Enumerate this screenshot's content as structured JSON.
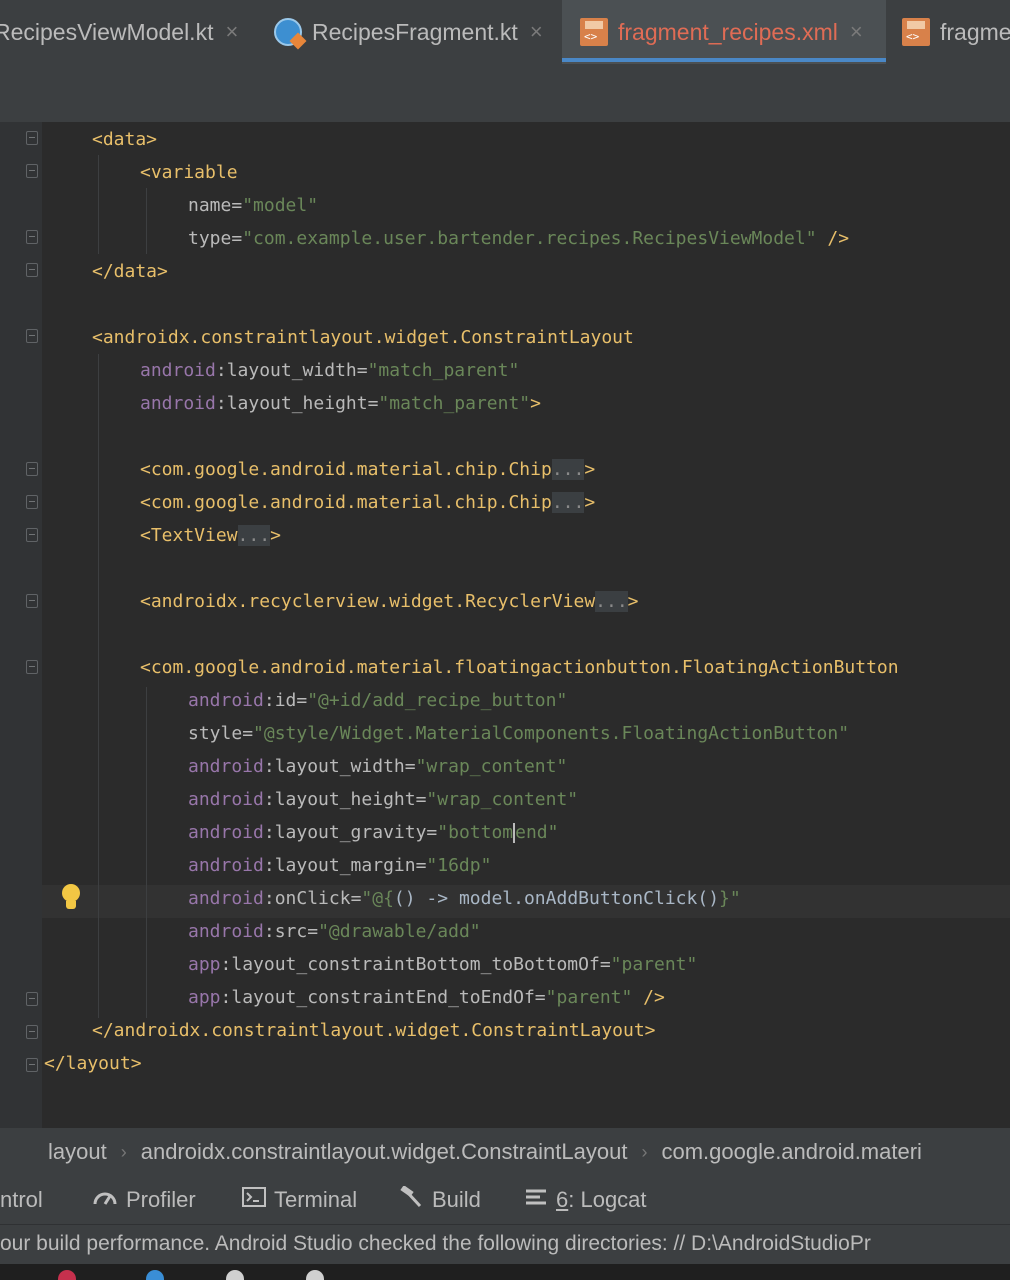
{
  "tabs": [
    {
      "label": "RecipesViewModel.kt",
      "icon": "kotlin-file-icon",
      "active": false
    },
    {
      "label": "RecipesFragment.kt",
      "icon": "kotlin-file-icon",
      "active": false
    },
    {
      "label": "fragment_recipes.xml",
      "icon": "xml-file-icon",
      "active": true
    },
    {
      "label": "fragme",
      "icon": "xml-file-icon",
      "active": false
    }
  ],
  "tab_close_glyph": "×",
  "code": {
    "l1": {
      "t1": "<data>"
    },
    "l2": {
      "t1": "<variable"
    },
    "l3": {
      "a1": "name",
      "eq": "=",
      "v1": "\"model\""
    },
    "l4": {
      "a1": "type",
      "eq": "=",
      "v1": "\"com.example.user.bartender.recipes.RecipesViewModel\"",
      "t2": " />"
    },
    "l5": {
      "t1": "</data>"
    },
    "l7": {
      "t1": "<androidx.constraintlayout.widget.ConstraintLayout"
    },
    "l8": {
      "ns": "android",
      "a1": ":layout_width",
      "eq": "=",
      "v1": "\"match_parent\""
    },
    "l9": {
      "ns": "android",
      "a1": ":layout_height",
      "eq": "=",
      "v1": "\"match_parent\"",
      "t2": ">"
    },
    "l11": {
      "t1": "<com.google.android.material.chip.Chip",
      "dots": "...",
      "t2": ">"
    },
    "l12": {
      "t1": "<com.google.android.material.chip.Chip",
      "dots": "...",
      "t2": ">"
    },
    "l13": {
      "t1": "<TextView",
      "dots": "...",
      "t2": ">"
    },
    "l15": {
      "t1": "<androidx.recyclerview.widget.RecyclerView",
      "dots": "...",
      "t2": ">"
    },
    "l17": {
      "t1": "<com.google.android.material.floatingactionbutton.FloatingActionButton"
    },
    "l18": {
      "ns": "android",
      "a1": ":id",
      "eq": "=",
      "v1": "\"@+id/add_recipe_button\""
    },
    "l19": {
      "a1": "style",
      "eq": "=",
      "v1": "\"@style/Widget.MaterialComponents.FloatingActionButton\""
    },
    "l20": {
      "ns": "android",
      "a1": ":layout_width",
      "eq": "=",
      "v1": "\"wrap_content\""
    },
    "l21": {
      "ns": "android",
      "a1": ":layout_height",
      "eq": "=",
      "v1": "\"wrap_content\""
    },
    "l22": {
      "ns": "android",
      "a1": ":layout_gravity",
      "eq": "=",
      "v1a": "\"bottom",
      "v1b": "end\""
    },
    "l23": {
      "ns": "android",
      "a1": ":layout_margin",
      "eq": "=",
      "v1": "\"16dp\""
    },
    "l24": {
      "ns": "android",
      "a1": ":onClick",
      "eq": "=",
      "v1a": "\"@{",
      "v1b": "() -> model.onAddButtonClick()",
      "v1c": "}\""
    },
    "l25": {
      "ns": "android",
      "a1": ":src",
      "eq": "=",
      "v1": "\"@drawable/add\""
    },
    "l26": {
      "ns": "app",
      "a1": ":layout_constraintBottom_toBottomOf",
      "eq": "=",
      "v1": "\"parent\""
    },
    "l27": {
      "ns": "app",
      "a1": ":layout_constraintEnd_toEndOf",
      "eq": "=",
      "v1": "\"parent\"",
      "t2": " />"
    },
    "l28": {
      "t1": "</androidx.constraintlayout.widget.ConstraintLayout>"
    },
    "l29": {
      "t1": "</layout>"
    }
  },
  "intention_icon": "lightbulb-icon",
  "breadcrumb": [
    "layout",
    "androidx.constraintlayout.widget.ConstraintLayout",
    "com.google.android.materi"
  ],
  "breadcrumb_sep": "›",
  "toolwindows": {
    "control": "ntrol",
    "profiler": "Profiler",
    "terminal": "Terminal",
    "build": "Build",
    "logcat_num": "6",
    "logcat_label": ": Logcat"
  },
  "status_message": "our build performance. Android Studio checked the following directories: // D:\\AndroidStudioPr",
  "colors": {
    "active_tab_text": "#e06c55",
    "tag": "#e8bf6a",
    "namespace": "#9876aa",
    "value": "#6a8759",
    "attribute": "#bababa",
    "editor_bg": "#2b2b2b"
  }
}
